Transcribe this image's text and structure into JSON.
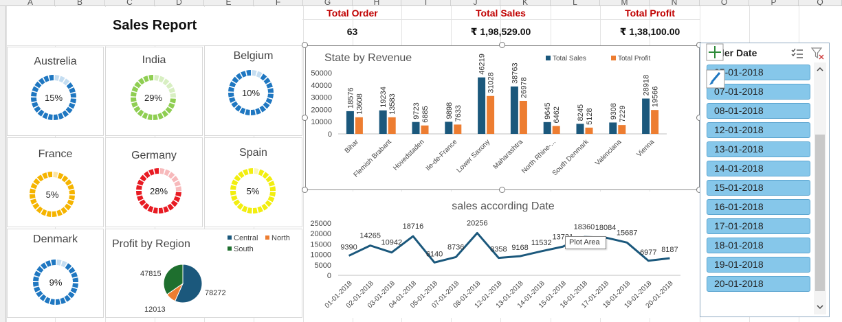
{
  "sheet": {
    "columns": [
      "A",
      "B",
      "C",
      "D",
      "E",
      "F",
      "G",
      "H",
      "I",
      "J",
      "K",
      "L",
      "M",
      "N",
      "O",
      "P",
      "Q"
    ]
  },
  "report_title": "Sales Report",
  "kpis": [
    {
      "label": "Total Order",
      "value": "63"
    },
    {
      "label": "Total Sales",
      "value": "₹ 1,98,529.00"
    },
    {
      "label": "Total Profit",
      "value": "₹ 1,38,100.00"
    }
  ],
  "countries": [
    {
      "name": "Austrelia",
      "pct_label": "15%",
      "fraction": 0.15,
      "color": "#1f77c1",
      "light": "#c4ddf1"
    },
    {
      "name": "India",
      "pct_label": "29%",
      "fraction": 0.29,
      "color": "#8fce52",
      "light": "#d8efc2"
    },
    {
      "name": "Belgium",
      "pct_label": "10%",
      "fraction": 0.1,
      "color": "#1f77c1",
      "light": "#c4ddf1"
    },
    {
      "name": "France",
      "pct_label": "5%",
      "fraction": 0.05,
      "color": "#f5b400",
      "light": "#fbe4a3"
    },
    {
      "name": "Germany",
      "pct_label": "28%",
      "fraction": 0.28,
      "color": "#e81b23",
      "light": "#f7b9bb"
    },
    {
      "name": "Spain",
      "pct_label": "5%",
      "fraction": 0.05,
      "color": "#f2ee0f",
      "light": "#faf7b6"
    },
    {
      "name": "Denmark",
      "pct_label": "9%",
      "fraction": 0.09,
      "color": "#1f77c1",
      "light": "#c4ddf1"
    }
  ],
  "chart_data": [
    {
      "type": "bar",
      "title": "State by Revenue",
      "categories": [
        "Bihar",
        "Flemish Brabant",
        "Hovedstaden",
        "Ile-de-France",
        "Lower Saxony",
        "Maharashtra",
        "North Rhine-...",
        "South Denmark",
        "Valenciana",
        "Vienna"
      ],
      "series": [
        {
          "name": "Total Sales",
          "color": "#1b587c",
          "values": [
            18576,
            19234,
            9723,
            9898,
            46219,
            38763,
            9645,
            8245,
            9308,
            28918
          ]
        },
        {
          "name": "Total Profit",
          "color": "#ed7d31",
          "values": [
            13608,
            13583,
            6885,
            7633,
            31028,
            26978,
            6462,
            5128,
            7229,
            19566
          ]
        }
      ],
      "ylim": [
        0,
        50000
      ],
      "yticks": [
        "0",
        "10000",
        "20000",
        "30000",
        "40000",
        "50000"
      ],
      "legend": "top-right"
    },
    {
      "type": "line",
      "title": "sales according Date",
      "x": [
        "01-01-2018",
        "02-01-2018",
        "03-01-2018",
        "04-01-2018",
        "05-01-2018",
        "07-01-2018",
        "08-01-2018",
        "12-01-2018",
        "13-01-2018",
        "14-01-2018",
        "15-01-2018",
        "16-01-2018",
        "17-01-2018",
        "18-01-2018",
        "19-01-2018",
        "20-01-2018"
      ],
      "series": [
        {
          "color": "#1b587c",
          "values": [
            9390,
            14265,
            10942,
            18716,
            6140,
            8736,
            20256,
            8358,
            9168,
            11532,
            13731,
            18360,
            18084,
            15687,
            6977,
            8187
          ]
        }
      ],
      "labels": [
        "9390",
        "14265",
        "10942",
        "18716",
        "6140",
        "8736",
        "20256",
        "8358",
        "9168",
        "11532",
        "13731",
        "18360",
        "18084",
        "15687",
        "6977",
        "8187"
      ],
      "ylim": [
        0,
        25000
      ],
      "yticks": [
        "0",
        "5000",
        "10000",
        "15000",
        "20000",
        "25000"
      ]
    },
    {
      "type": "pie",
      "title": "Profit by Region",
      "categories": [
        "Central",
        "North",
        "South"
      ],
      "values": [
        78272,
        12013,
        47815
      ],
      "labels": [
        "78272",
        "12013",
        "47815"
      ],
      "colors": [
        "#1b587c",
        "#ed7d31",
        "#1e6f2e"
      ],
      "legend": "top-right"
    }
  ],
  "tooltip": "Plot Area",
  "slicer": {
    "header": "Order Date",
    "items": [
      "05-01-2018",
      "07-01-2018",
      "08-01-2018",
      "12-01-2018",
      "13-01-2018",
      "14-01-2018",
      "15-01-2018",
      "16-01-2018",
      "17-01-2018",
      "18-01-2018",
      "19-01-2018",
      "20-01-2018"
    ]
  }
}
